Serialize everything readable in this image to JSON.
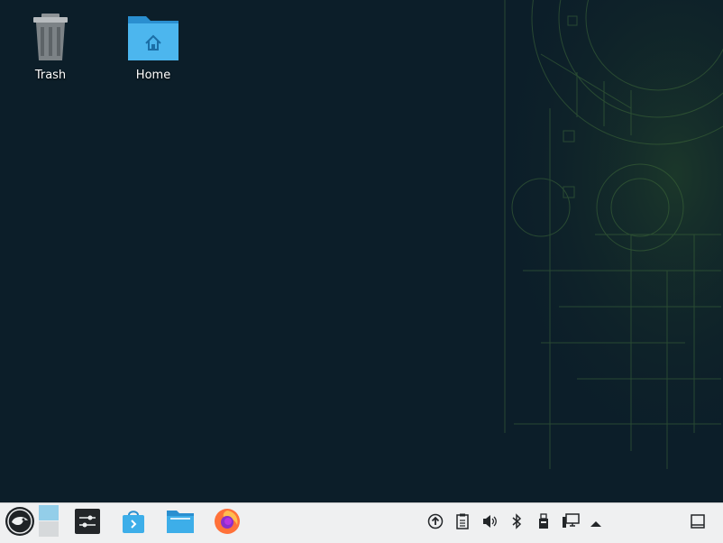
{
  "desktop": {
    "icons": [
      {
        "label": "Trash",
        "icon": "trash-icon"
      },
      {
        "label": "Home",
        "icon": "home-folder-icon"
      }
    ]
  },
  "taskbar": {
    "launchers": [
      {
        "name": "application-launcher",
        "icon": "opensuse-gecko-icon"
      },
      {
        "name": "pager",
        "icon": "virtual-desktop-pager-icon"
      },
      {
        "name": "system-settings",
        "icon": "settings-sliders-icon"
      },
      {
        "name": "software-center",
        "icon": "discover-bag-icon"
      },
      {
        "name": "file-manager",
        "icon": "folder-icon"
      },
      {
        "name": "firefox",
        "icon": "firefox-icon"
      }
    ],
    "tray": [
      {
        "name": "updates",
        "icon": "update-arrow-icon"
      },
      {
        "name": "clipboard",
        "icon": "clipboard-icon"
      },
      {
        "name": "volume",
        "icon": "speaker-icon"
      },
      {
        "name": "bluetooth",
        "icon": "bluetooth-icon"
      },
      {
        "name": "removable-devices",
        "icon": "usb-drive-icon"
      },
      {
        "name": "network",
        "icon": "network-monitor-icon"
      },
      {
        "name": "expand-tray",
        "icon": "up-triangle-icon"
      },
      {
        "name": "show-desktop",
        "icon": "show-desktop-icon"
      }
    ]
  },
  "colors": {
    "desktop_bg": "#0c1e29",
    "wallpaper_lines": "#3f6b3a",
    "taskbar_bg": "#eff0f1",
    "folder_blue": "#3daee9"
  }
}
